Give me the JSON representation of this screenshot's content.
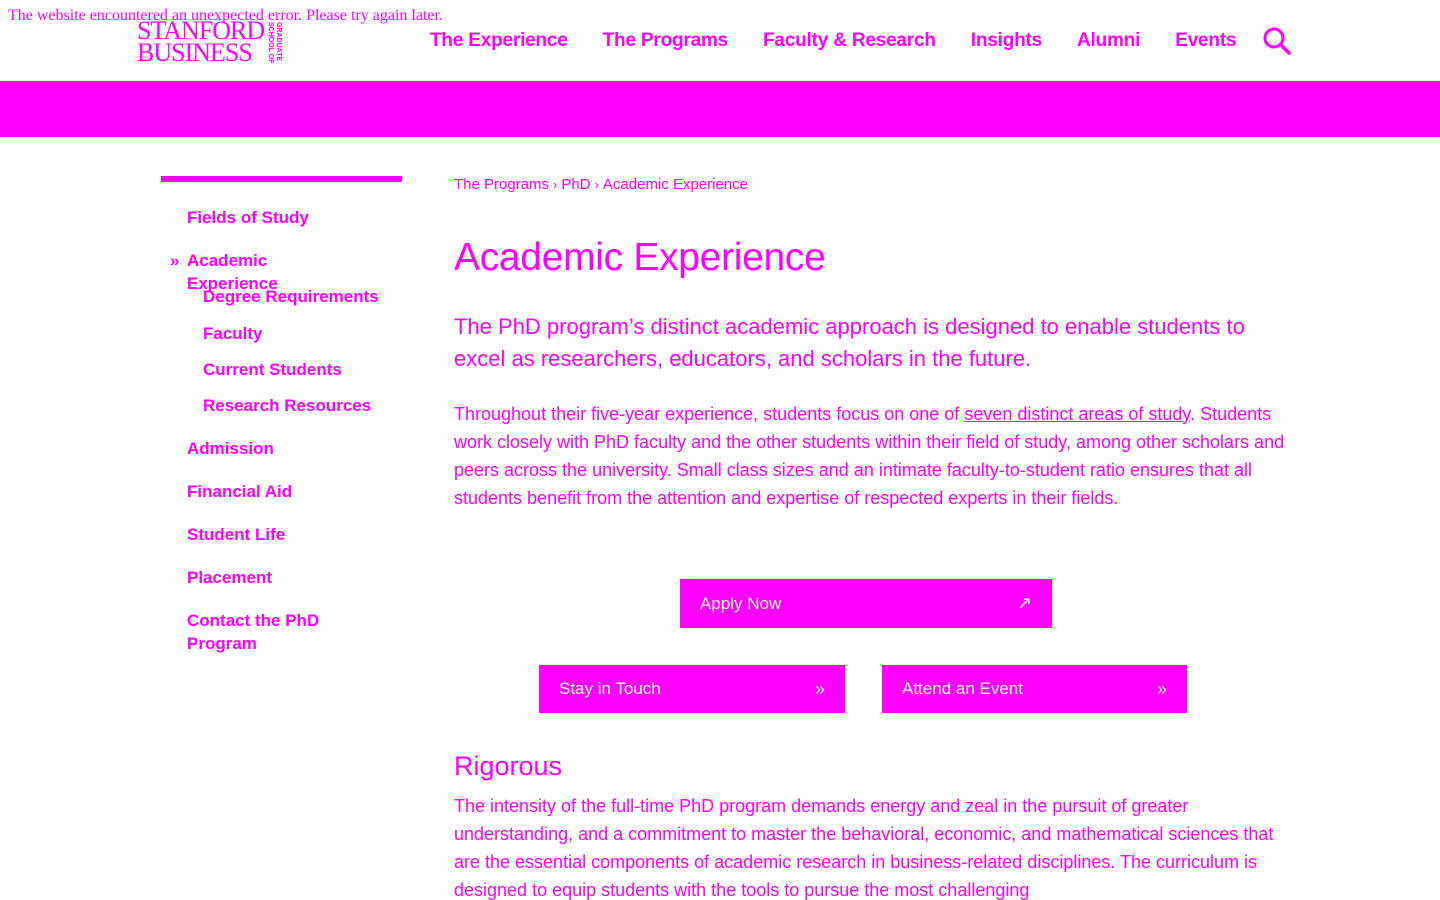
{
  "error_message": "The website encountered an unexpected error. Please try again later.",
  "logo": {
    "line1": "STANFORD",
    "line2": "BUSINESS",
    "side": "GRADUATE SCHOOL OF"
  },
  "topnav": [
    "The Experience",
    "The Programs",
    "Faculty & Research",
    "Insights",
    "Alumni",
    "Events"
  ],
  "search_icon": "search-icon",
  "sidenav": {
    "fields_of_study": "Fields of Study",
    "academic_experience": "Academic Experience",
    "active_marker": "»",
    "sub": [
      "Degree Requirements",
      "Faculty",
      "Current Students",
      "Research Resources"
    ],
    "admission": "Admission",
    "financial_aid": "Financial Aid",
    "student_life": "Student Life",
    "placement": "Placement",
    "contact_line1": "Contact the PhD",
    "contact_line2": "Program"
  },
  "breadcrumb": {
    "items": [
      "The Programs",
      "PhD",
      "Academic Experience"
    ],
    "separator": "›"
  },
  "page_title": "Academic Experience",
  "lede": "The PhD program’s distinct academic approach is designed to enable students to excel as researchers, educators, and scholars in the future.",
  "body1": {
    "before_link": "Throughout their five-year experience, students focus on one of ",
    "link": "seven distinct areas of study",
    "after_link": ". Students work closely with PhD faculty and the other students within their field of study, among other scholars and peers across the university. Small class sizes and an intimate faculty-to-student ratio ensures that all students benefit from the attention and expertise of respected experts in their fields."
  },
  "buttons": {
    "apply": "Apply Now",
    "apply_icon": "↗",
    "touch": "Stay in Touch",
    "event": "Attend an Event",
    "chevron": "»"
  },
  "section_heading": "Rigorous",
  "body2": "The intensity of the full-time PhD program demands energy and zeal in the pursuit of greater understanding, and a commitment to master the behavioral, economic, and mathematical sciences that are the essential components of academic research in business-related disciplines. The curriculum is designed to equip students with the tools to pursue the most challenging",
  "colors": {
    "accent": "#ff00ff",
    "background": "#ffffff"
  }
}
